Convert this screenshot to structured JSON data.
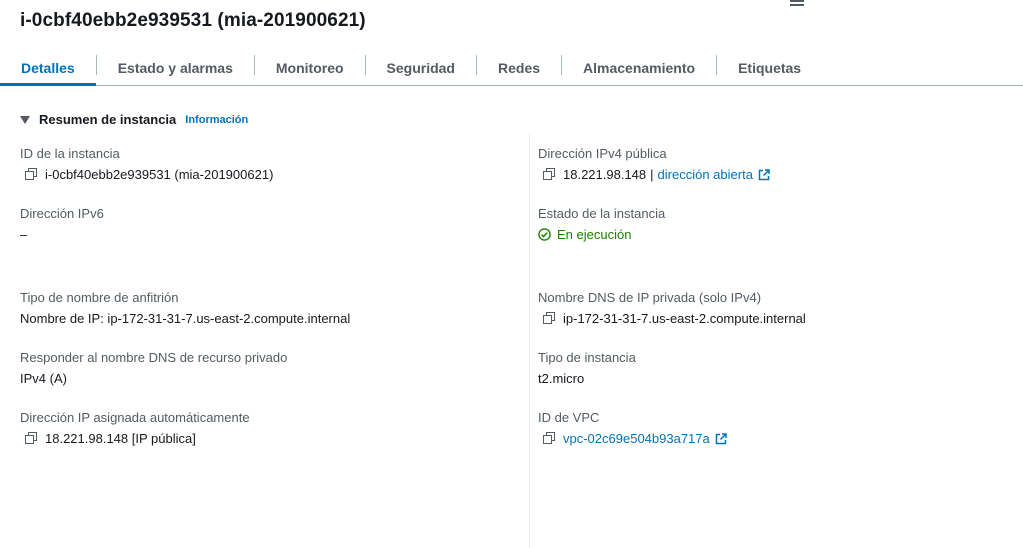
{
  "header": {
    "title": "i-0cbf40ebb2e939531 (mia-201900621)"
  },
  "tabs": [
    {
      "label": "Detalles",
      "active": true
    },
    {
      "label": "Estado y alarmas"
    },
    {
      "label": "Monitoreo"
    },
    {
      "label": "Seguridad"
    },
    {
      "label": "Redes"
    },
    {
      "label": "Almacenamiento"
    },
    {
      "label": "Etiquetas"
    }
  ],
  "section": {
    "title": "Resumen de instancia",
    "info": "Información"
  },
  "fields": {
    "instance_id": {
      "label": "ID de la instancia",
      "value": "i-0cbf40ebb2e939531 (mia-201900621)"
    },
    "ipv6": {
      "label": "Dirección IPv6",
      "value": "–"
    },
    "hostname_type": {
      "label": "Tipo de nombre de anfitrión",
      "value": "Nombre de IP: ip-172-31-31-7.us-east-2.compute.internal"
    },
    "dns_respond": {
      "label": "Responder al nombre DNS de recurso privado",
      "value": "IPv4 (A)"
    },
    "auto_ip": {
      "label": "Dirección IP asignada automáticamente",
      "value": "18.221.98.148 [IP pública]"
    },
    "public_ipv4": {
      "label": "Dirección IPv4 pública",
      "value": "18.221.98.148",
      "separator": "|",
      "link": "dirección abierta"
    },
    "state": {
      "label": "Estado de la instancia",
      "value": "En ejecución"
    },
    "private_dns": {
      "label": "Nombre DNS de IP privada (solo IPv4)",
      "value": "ip-172-31-31-7.us-east-2.compute.internal"
    },
    "instance_type": {
      "label": "Tipo de instancia",
      "value": "t2.micro"
    },
    "vpc": {
      "label": "ID de VPC",
      "value": "vpc-02c69e504b93a717a"
    }
  },
  "colors": {
    "accent": "#0073bb",
    "success": "#1d8102"
  }
}
